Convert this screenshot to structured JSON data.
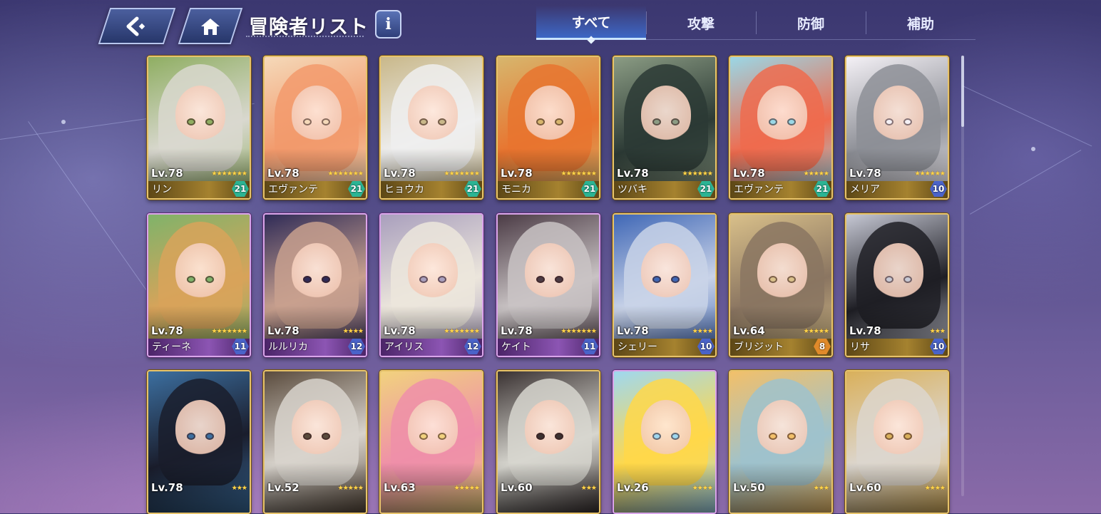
{
  "header": {
    "title": "冒険者リスト",
    "back_icon": "back-arrow-icon",
    "home_icon": "home-icon",
    "info_label": "i"
  },
  "tabs": [
    {
      "label": "すべて",
      "active": true
    },
    {
      "label": "攻撃",
      "active": false
    },
    {
      "label": "防御",
      "active": false
    },
    {
      "label": "補助",
      "active": false
    }
  ],
  "colors": {
    "gold_frame": "#e7c36b",
    "purple_frame": "#d9a6ea",
    "badge_green": "#2bb494",
    "badge_blue": "#4a63c9",
    "badge_orange": "#e08a2a",
    "tab_active": "#3c6ed2"
  },
  "cards": [
    {
      "level": "Lv.78",
      "name": "リン",
      "stars": 7,
      "badge": "21",
      "frame": "gold",
      "badge_color": "green",
      "palette": [
        "#d9d8cf",
        "#8fae62"
      ]
    },
    {
      "level": "Lv.78",
      "name": "エヴァンテ",
      "stars": 7,
      "badge": "21",
      "frame": "gold",
      "badge_color": "green",
      "palette": [
        "#f29a6c",
        "#f5d9b9"
      ]
    },
    {
      "level": "Lv.78",
      "name": "ヒョウカ",
      "stars": 7,
      "badge": "21",
      "frame": "gold",
      "badge_color": "green",
      "palette": [
        "#eeeeee",
        "#c9b88a"
      ]
    },
    {
      "level": "Lv.78",
      "name": "モニカ",
      "stars": 7,
      "badge": "21",
      "frame": "gold",
      "badge_color": "green",
      "palette": [
        "#e8742f",
        "#d7b66d"
      ]
    },
    {
      "level": "Lv.78",
      "name": "ツバキ",
      "stars": 6,
      "badge": "21",
      "frame": "gold",
      "badge_color": "green",
      "palette": [
        "#2c3a35",
        "#8b9c84"
      ]
    },
    {
      "level": "Lv.78",
      "name": "エヴァンテ",
      "stars": 5,
      "badge": "21",
      "frame": "gold",
      "badge_color": "green",
      "palette": [
        "#ef6b4e",
        "#9ad7e6"
      ]
    },
    {
      "level": "Lv.78",
      "name": "メリア",
      "stars": 6,
      "badge": "10",
      "frame": "gold",
      "badge_color": "blue",
      "palette": [
        "#8d8f96",
        "#f4f1f6"
      ]
    },
    {
      "level": "Lv.78",
      "name": "ティーネ",
      "stars": 7,
      "badge": "11",
      "frame": "purple",
      "badge_color": "blue",
      "palette": [
        "#d8a35a",
        "#7fb36a"
      ]
    },
    {
      "level": "Lv.78",
      "name": "ルルリカ",
      "stars": 4,
      "badge": "12",
      "frame": "purple",
      "badge_color": "blue",
      "palette": [
        "#c8a08e",
        "#2f2b57"
      ]
    },
    {
      "level": "Lv.78",
      "name": "アイリス",
      "stars": 7,
      "badge": "12",
      "frame": "purple",
      "badge_color": "blue",
      "palette": [
        "#ece6dc",
        "#a99fbd"
      ]
    },
    {
      "level": "Lv.78",
      "name": "ケイト",
      "stars": 7,
      "badge": "11",
      "frame": "purple",
      "badge_color": "blue",
      "palette": [
        "#c9c3c4",
        "#4b3b45"
      ]
    },
    {
      "level": "Lv.78",
      "name": "シェリー",
      "stars": 4,
      "badge": "10",
      "frame": "gold",
      "badge_color": "blue",
      "palette": [
        "#c9d3e8",
        "#3f67b6"
      ]
    },
    {
      "level": "Lv.64",
      "name": "ブリジット",
      "stars": 5,
      "badge": "8",
      "frame": "gold",
      "badge_color": "orange",
      "palette": [
        "#8a7561",
        "#d9c08a"
      ]
    },
    {
      "level": "Lv.78",
      "name": "リサ",
      "stars": 3,
      "badge": "10",
      "frame": "gold",
      "badge_color": "blue",
      "palette": [
        "#1e1e24",
        "#c6c8d4"
      ]
    },
    {
      "level": "Lv.78",
      "name": "",
      "stars": 3,
      "badge": "",
      "frame": "gold",
      "badge_color": "",
      "palette": [
        "#1a1d2c",
        "#3c6fa0"
      ]
    },
    {
      "level": "Lv.52",
      "name": "",
      "stars": 5,
      "badge": "",
      "frame": "gold",
      "badge_color": "",
      "palette": [
        "#d8d3cc",
        "#5a4b3d"
      ]
    },
    {
      "level": "Lv.63",
      "name": "",
      "stars": 5,
      "badge": "",
      "frame": "gold",
      "badge_color": "",
      "palette": [
        "#ef8fa9",
        "#f1d27e"
      ]
    },
    {
      "level": "Lv.60",
      "name": "",
      "stars": 3,
      "badge": "",
      "frame": "gold",
      "badge_color": "",
      "palette": [
        "#d7d6cf",
        "#3a3232"
      ]
    },
    {
      "level": "Lv.26",
      "name": "",
      "stars": 4,
      "badge": "",
      "frame": "purple",
      "badge_color": "",
      "palette": [
        "#ffd84a",
        "#9fd8f0"
      ]
    },
    {
      "level": "Lv.50",
      "name": "",
      "stars": 3,
      "badge": "",
      "frame": "gold",
      "badge_color": "",
      "palette": [
        "#9fc2cc",
        "#f2c06a"
      ]
    },
    {
      "level": "Lv.60",
      "name": "",
      "stars": 4,
      "badge": "",
      "frame": "gold",
      "badge_color": "",
      "palette": [
        "#dcd6ce",
        "#d9b05b"
      ]
    }
  ]
}
